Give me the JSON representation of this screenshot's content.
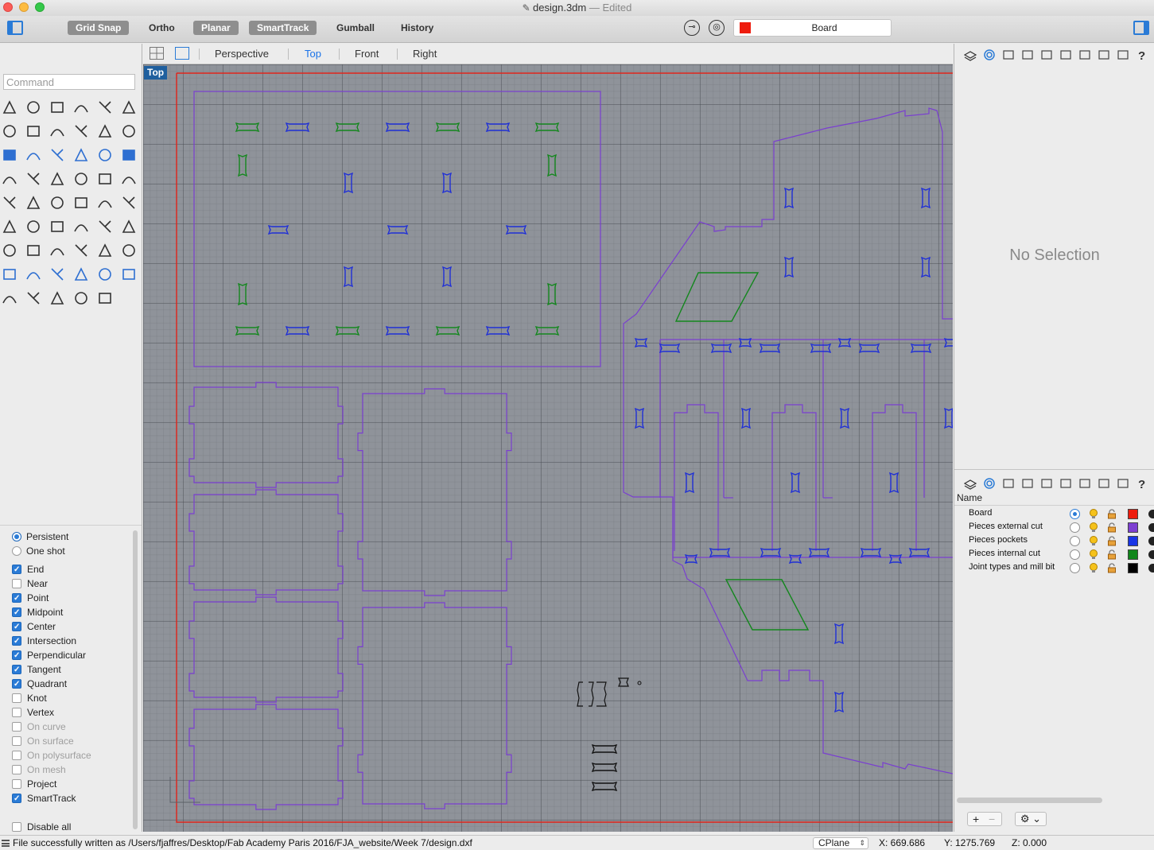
{
  "window": {
    "title": "design.3dm",
    "edited": "— Edited"
  },
  "toolbar": {
    "grid_snap": "Grid Snap",
    "ortho": "Ortho",
    "planar": "Planar",
    "smarttrack": "SmartTrack",
    "gumball": "Gumball",
    "history": "History",
    "current_layer": "Board",
    "current_layer_color": "#ee1c0e"
  },
  "command": {
    "placeholder": "Command"
  },
  "viewport_tabs": {
    "perspective": "Perspective",
    "top": "Top",
    "front": "Front",
    "right": "Right",
    "active": "Top"
  },
  "viewport": {
    "label": "Top"
  },
  "osnap": {
    "mode_persistent": "Persistent",
    "mode_one_shot": "One shot",
    "items": [
      {
        "label": "End",
        "checked": true
      },
      {
        "label": "Near",
        "checked": false
      },
      {
        "label": "Point",
        "checked": true
      },
      {
        "label": "Midpoint",
        "checked": true
      },
      {
        "label": "Center",
        "checked": true
      },
      {
        "label": "Intersection",
        "checked": true
      },
      {
        "label": "Perpendicular",
        "checked": true
      },
      {
        "label": "Tangent",
        "checked": true
      },
      {
        "label": "Quadrant",
        "checked": true
      },
      {
        "label": "Knot",
        "checked": false
      },
      {
        "label": "Vertex",
        "checked": false
      },
      {
        "label": "On curve",
        "checked": false
      },
      {
        "label": "On surface",
        "checked": false
      },
      {
        "label": "On polysurface",
        "checked": false
      },
      {
        "label": "On mesh",
        "checked": false
      },
      {
        "label": "Project",
        "checked": false
      },
      {
        "label": "SmartTrack",
        "checked": true
      }
    ],
    "disable_all": "Disable all"
  },
  "properties": {
    "no_selection": "No Selection"
  },
  "layers": {
    "header_name": "Name",
    "items": [
      {
        "name": "Board",
        "color": "#ee1c0e",
        "current": true
      },
      {
        "name": "Pieces external cut",
        "color": "#7d3fd1",
        "current": false
      },
      {
        "name": "Pieces pockets",
        "color": "#1935e6",
        "current": false
      },
      {
        "name": "Pieces internal cut",
        "color": "#10861b",
        "current": false
      },
      {
        "name": "Joint types and mill bit",
        "color": "#000000",
        "current": false
      }
    ]
  },
  "status": {
    "message": "File successfully written as /Users/fjaffres/Desktop/Fab Academy Paris 2016/FJA_website/Week 7/design.dxf",
    "cplane": "CPlane",
    "x": "X: 669.686",
    "y": "Y: 1275.769",
    "z": "Z: 0.000"
  },
  "colors": {
    "board": "#e0241a",
    "external": "#7a3fd0",
    "pockets": "#1f2fd6",
    "internal": "#13871d",
    "joints": "#111111"
  }
}
